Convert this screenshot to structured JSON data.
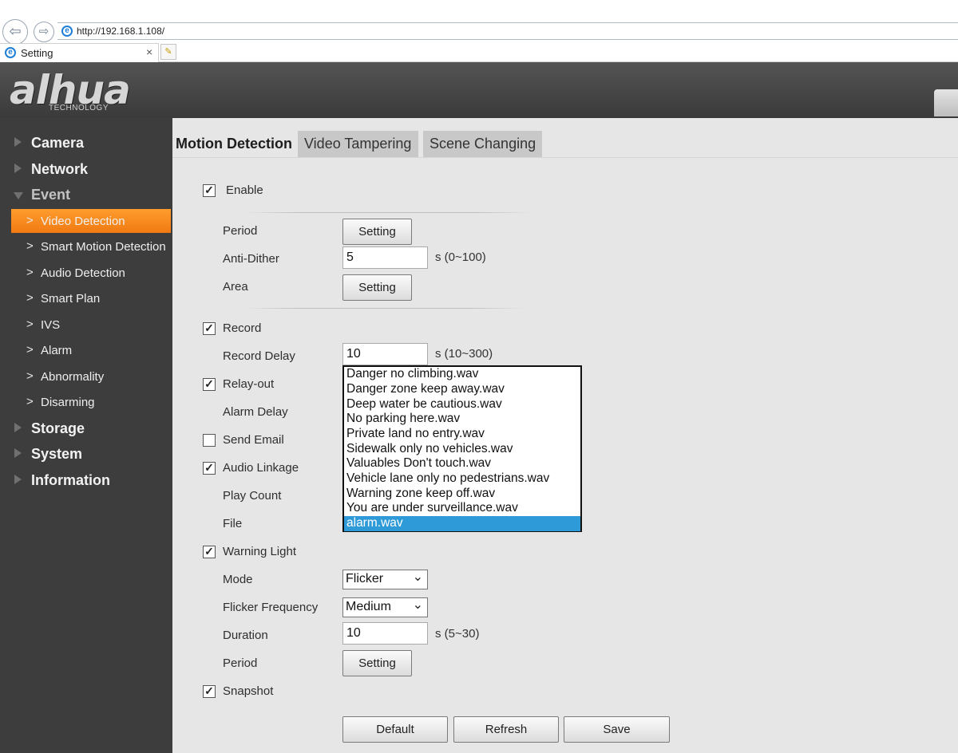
{
  "browser": {
    "url": "http://192.168.1.108/",
    "tab_title": "Setting",
    "tab_close": "×"
  },
  "header": {
    "logo_text": "alhua",
    "logo_sub": "TECHNOLOGY"
  },
  "sidebar": {
    "top_items": [
      {
        "label": "Camera",
        "expanded": false
      },
      {
        "label": "Network",
        "expanded": false
      },
      {
        "label": "Event",
        "expanded": true
      },
      {
        "label": "Storage",
        "expanded": false
      },
      {
        "label": "System",
        "expanded": false
      },
      {
        "label": "Information",
        "expanded": false
      }
    ],
    "event_items": [
      {
        "label": "Video Detection",
        "active": true
      },
      {
        "label": "Smart Motion Detection"
      },
      {
        "label": "Audio Detection"
      },
      {
        "label": "Smart Plan"
      },
      {
        "label": "IVS"
      },
      {
        "label": "Alarm"
      },
      {
        "label": "Abnormality"
      },
      {
        "label": "Disarming"
      }
    ]
  },
  "tabs": [
    {
      "label": "Motion Detection",
      "active": true
    },
    {
      "label": "Video Tampering"
    },
    {
      "label": "Scene Changing"
    }
  ],
  "form": {
    "enable": {
      "label": "Enable",
      "checked": true
    },
    "period": {
      "label": "Period",
      "button": "Setting"
    },
    "anti_dither": {
      "label": "Anti-Dither",
      "value": "5",
      "unit": "s (0~100)"
    },
    "area": {
      "label": "Area",
      "button": "Setting"
    },
    "record": {
      "label": "Record",
      "checked": true
    },
    "record_delay": {
      "label": "Record Delay",
      "value": "10",
      "unit": "s (10~300)"
    },
    "relay_out": {
      "label": "Relay-out",
      "checked": true
    },
    "alarm_delay": {
      "label": "Alarm Delay"
    },
    "send_email": {
      "label": "Send Email",
      "checked": false
    },
    "audio_linkage": {
      "label": "Audio Linkage",
      "checked": true
    },
    "play_count": {
      "label": "Play Count"
    },
    "file": {
      "label": "File"
    },
    "file_options": [
      "Danger no climbing.wav",
      "Danger zone keep away.wav",
      "Deep water be cautious.wav",
      "No parking here.wav",
      "Private land no entry.wav",
      "Sidewalk only no vehicles.wav",
      "Valuables Don't touch.wav",
      "Vehicle lane only no pedestrians.wav",
      "Warning zone keep off.wav",
      "You are under surveillance.wav",
      "alarm.wav"
    ],
    "file_selected": "alarm.wav",
    "warning_light": {
      "label": "Warning Light",
      "checked": true
    },
    "mode": {
      "label": "Mode",
      "value": "Flicker"
    },
    "flicker_frequency": {
      "label": "Flicker Frequency",
      "value": "Medium"
    },
    "duration": {
      "label": "Duration",
      "value": "10",
      "unit": "s (5~30)"
    },
    "period2": {
      "label": "Period",
      "button": "Setting"
    },
    "snapshot": {
      "label": "Snapshot",
      "checked": true
    },
    "check_mark": "✓"
  },
  "actions": {
    "default": "Default",
    "refresh": "Refresh",
    "save": "Save"
  },
  "icons": {
    "back": "back-arrow-icon",
    "forward": "forward-arrow-icon",
    "ie": "ie-page-icon",
    "new_tab": "new-tab-icon"
  }
}
